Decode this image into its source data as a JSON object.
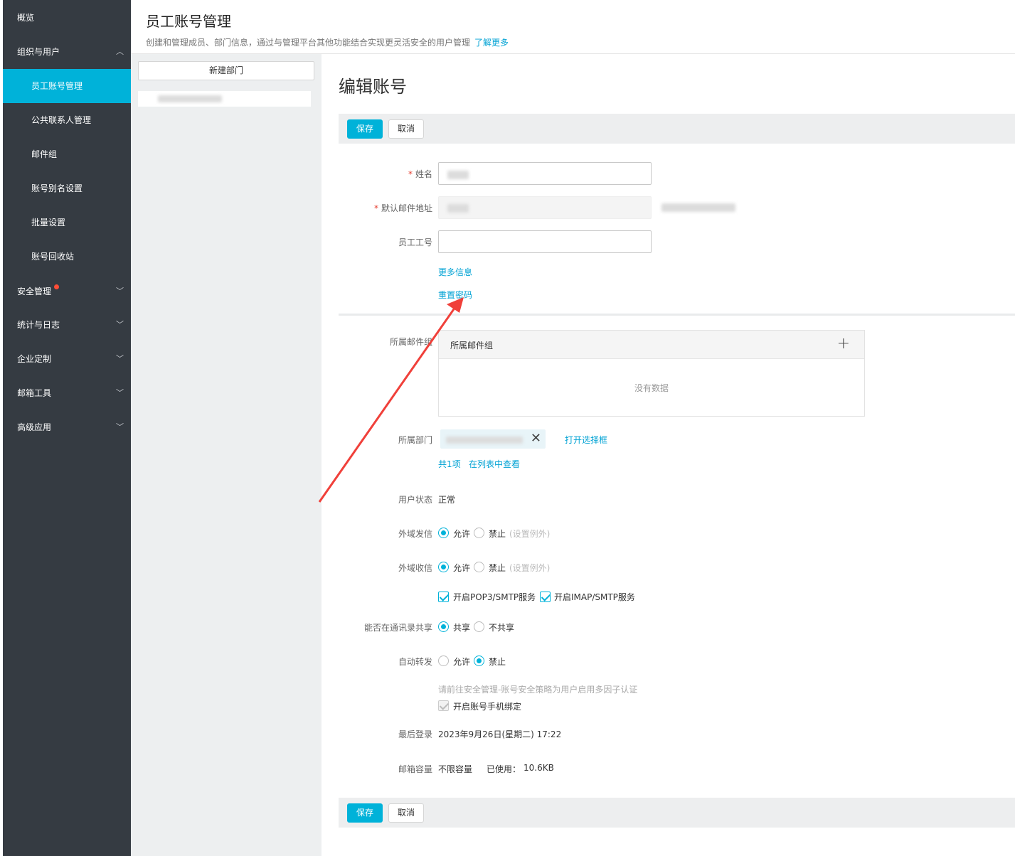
{
  "sidebar": {
    "items": [
      {
        "label": "概览"
      },
      {
        "label": "组织与用户"
      },
      {
        "label": "员工账号管理"
      },
      {
        "label": "公共联系人管理"
      },
      {
        "label": "邮件组"
      },
      {
        "label": "账号别名设置"
      },
      {
        "label": "批量设置"
      },
      {
        "label": "账号回收站"
      },
      {
        "label": "安全管理"
      },
      {
        "label": "统计与日志"
      },
      {
        "label": "企业定制"
      },
      {
        "label": "邮箱工具"
      },
      {
        "label": "高级应用"
      }
    ]
  },
  "header": {
    "title": "员工账号管理",
    "description": "创建和管理成员、部门信息，通过与管理平台其他功能结合实现更灵活安全的用户管理",
    "learn_more": "了解更多"
  },
  "dept": {
    "new_button": "新建部门"
  },
  "form": {
    "title": "编辑账号",
    "save": "保存",
    "cancel": "取消",
    "name_label": "姓名",
    "email_label": "默认邮件地址",
    "employee_id_label": "员工工号",
    "more_info": "更多信息",
    "reset_password": "重置密码",
    "mail_group_label": "所属邮件组",
    "mail_group_header": "所属邮件组",
    "no_data": "没有数据",
    "dept_label": "所属部门",
    "open_selector": "打开选择框",
    "total": "共1项",
    "view_in_list": "在列表中查看",
    "status_label": "用户状态",
    "status_value": "正常",
    "outbound_label": "外域发信",
    "inbound_label": "外域收信",
    "allow": "允许",
    "forbid": "禁止",
    "exception": "(设置例外)",
    "pop3": "开启POP3/SMTP服务",
    "imap": "开启IMAP/SMTP服务",
    "share_label": "能否在通讯录共享",
    "share": "共享",
    "no_share": "不共享",
    "forward_label": "自动转发",
    "mfa_hint": "请前往安全管理-账号安全策略为用户启用多因子认证",
    "phone_bind": "开启账号手机绑定",
    "last_login_label": "最后登录",
    "last_login_value": "2023年9月26日(星期二) 17:22",
    "capacity_label": "邮箱容量",
    "capacity_value": "不限容量",
    "used_label": "已使用：",
    "used_value": "10.6KB"
  },
  "colors": {
    "accent": "#00b2d9",
    "sidebar": "#353b42",
    "arrow": "#f0403a"
  }
}
